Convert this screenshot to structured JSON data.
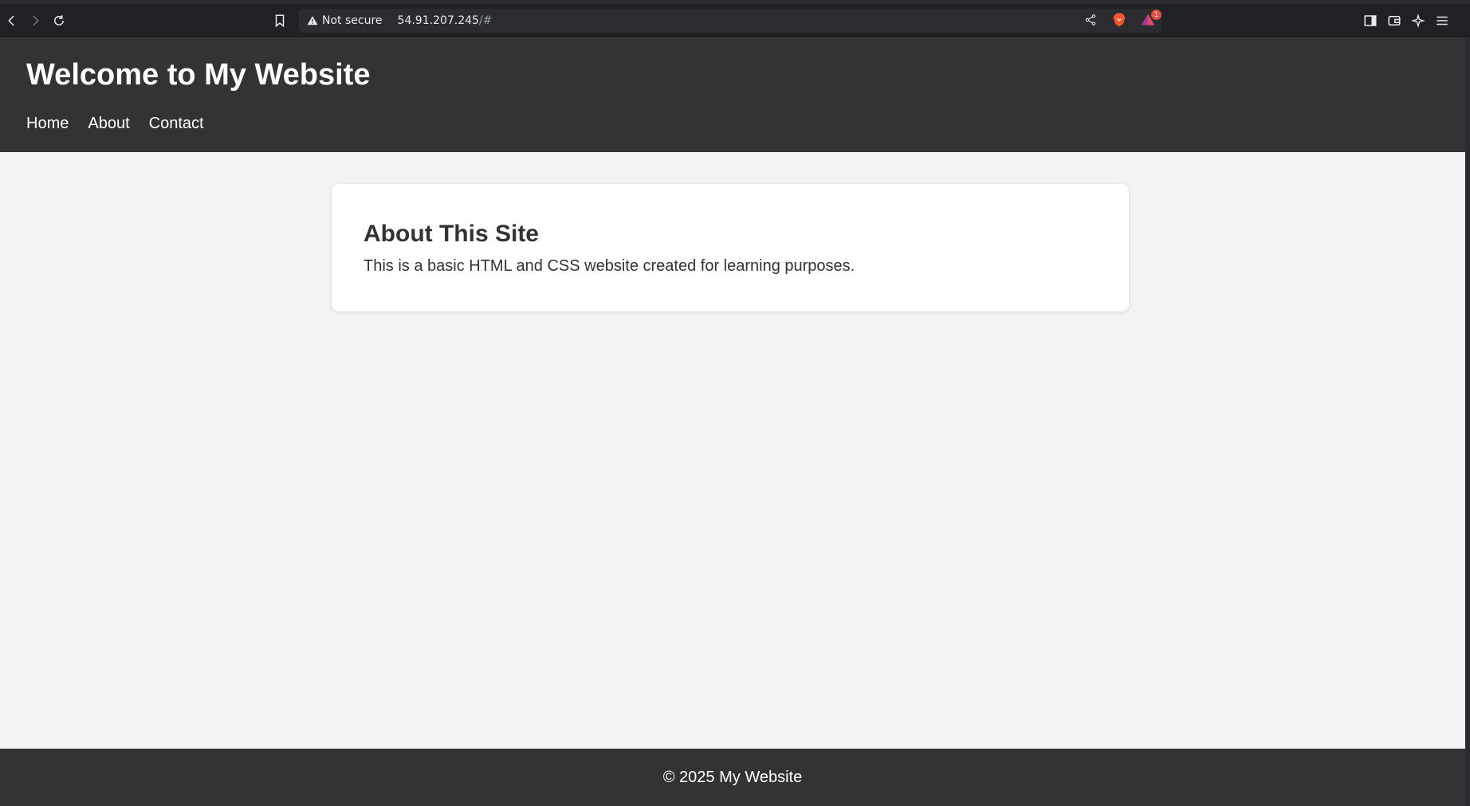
{
  "browser": {
    "security_label": "Not secure",
    "url_host": "54.91.207.245",
    "url_path": "/#",
    "notification_count": "1"
  },
  "header": {
    "title": "Welcome to My Website",
    "nav": [
      {
        "label": "Home"
      },
      {
        "label": "About"
      },
      {
        "label": "Contact"
      }
    ]
  },
  "main": {
    "heading": "About This Site",
    "body": "This is a basic HTML and CSS website created for learning purposes."
  },
  "footer": {
    "text": "© 2025 My Website"
  },
  "colors": {
    "header_bg": "#333333",
    "page_bg": "#f3f3f3",
    "card_bg": "#ffffff",
    "text": "#333333",
    "browser_bg": "#202124"
  }
}
